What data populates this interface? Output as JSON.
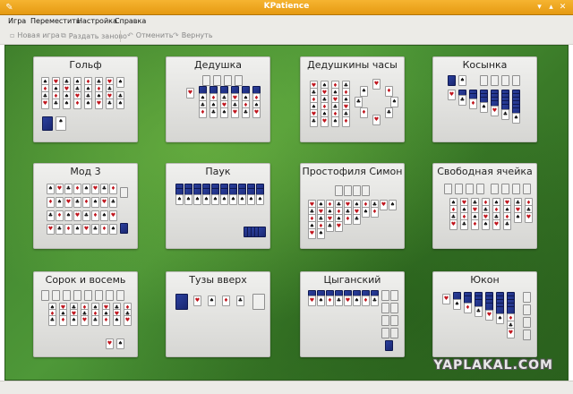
{
  "window": {
    "title": "KPatience"
  },
  "menu": {
    "items": [
      "Игра",
      "Переместить",
      "Настройка",
      "Справка"
    ]
  },
  "toolbar": {
    "new_game": "Новая игра",
    "restart": "Раздать заново",
    "undo": "Отменить",
    "redo": "Вернуть"
  },
  "games": [
    "Гольф",
    "Дедушка",
    "Дедушкины часы",
    "Косынка",
    "Мод 3",
    "Паук",
    "Простофиля Симон",
    "Свободная ячейка",
    "Сорок и восемь",
    "Тузы вверх",
    "Цыганский",
    "Юкон"
  ],
  "watermark": "YAPLAKAL.COM"
}
